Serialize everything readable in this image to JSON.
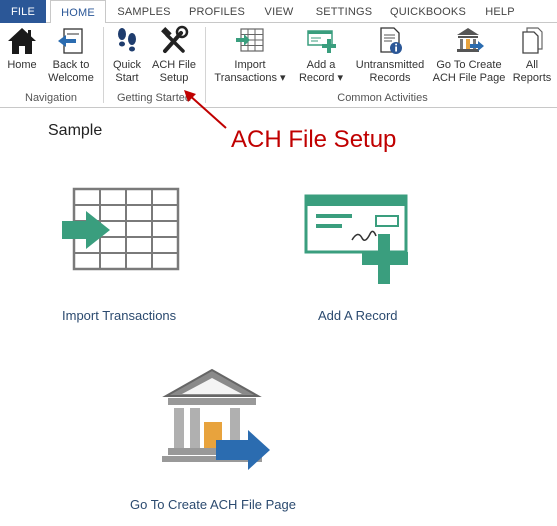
{
  "tabs": [
    "FILE",
    "HOME",
    "SAMPLES",
    "PROFILES",
    "VIEW",
    "SETTINGS",
    "QUICKBOOKS",
    "HELP"
  ],
  "ribbon": {
    "home": [
      "Home",
      ""
    ],
    "back": [
      "Back to",
      "Welcome"
    ],
    "quick": [
      "Quick",
      "Start"
    ],
    "ach": [
      "ACH File",
      "Setup"
    ],
    "import": [
      "Import",
      "Transactions ▾"
    ],
    "add": [
      "Add a",
      "Record ▾"
    ],
    "untrans": [
      "Untransmitted",
      "Records"
    ],
    "goto": [
      "Go To Create",
      "ACH File Page"
    ],
    "all": [
      "All",
      "Reports"
    ],
    "groups": {
      "navigation": "Navigation",
      "getting_started": "Getting Started",
      "common": "Common Activities"
    }
  },
  "annotation": "ACH File Setup",
  "main": {
    "title": "Sample",
    "tiles": {
      "import": "Import Transactions",
      "add": "Add A Record",
      "goto": "Go To Create ACH File Page"
    }
  },
  "colors": {
    "file_tab": "#2b5797",
    "green": "#3a9e7e",
    "blue": "#2b6cb0",
    "annotation": "#c00000"
  }
}
